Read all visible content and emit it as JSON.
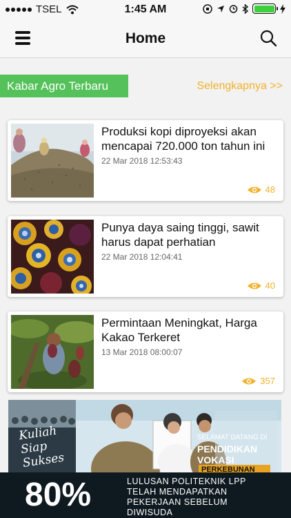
{
  "status_bar": {
    "carrier": "TSEL",
    "time": "1:45 AM"
  },
  "header": {
    "title": "Home",
    "menu_icon": "hamburger-menu-icon",
    "search_icon": "search-icon"
  },
  "section": {
    "label": "Kabar Agro Terbaru",
    "more_link": "Selengkapnya >>"
  },
  "articles": [
    {
      "title": "Produksi kopi diproyeksi akan mencapai 720.000 ton tahun ini",
      "date": "22 Mar 2018 12:53:43",
      "views": "48"
    },
    {
      "title": "Punya daya saing tinggi, sawit harus dapat perhatian",
      "date": "22 Mar 2018 12:04:41",
      "views": "40"
    },
    {
      "title": "Permintaan Meningkat, Harga Kakao Terkeret",
      "date": "13 Mar 2018 08:00:07",
      "views": "357"
    }
  ],
  "banner": {
    "tagline_line1": "Kuliah",
    "tagline_line2": "Siap",
    "tagline_line3": "Sukses",
    "welcome": "SELAMAT DATANG DI",
    "program_line1": "PENDIDIKAN",
    "program_line2": "VOKASI",
    "program_line3": "PERKEBUNAN",
    "percent": "80%",
    "bottom_line1": "LULUSAN POLITEKNIK LPP",
    "bottom_line2": "TELAH MENDAPATKAN",
    "bottom_line3": "PEKERJAAN SEBELUM",
    "bottom_line4": "DIWISUDA"
  },
  "colors": {
    "accent_green": "#55c15a",
    "accent_orange": "#f2b12a"
  }
}
